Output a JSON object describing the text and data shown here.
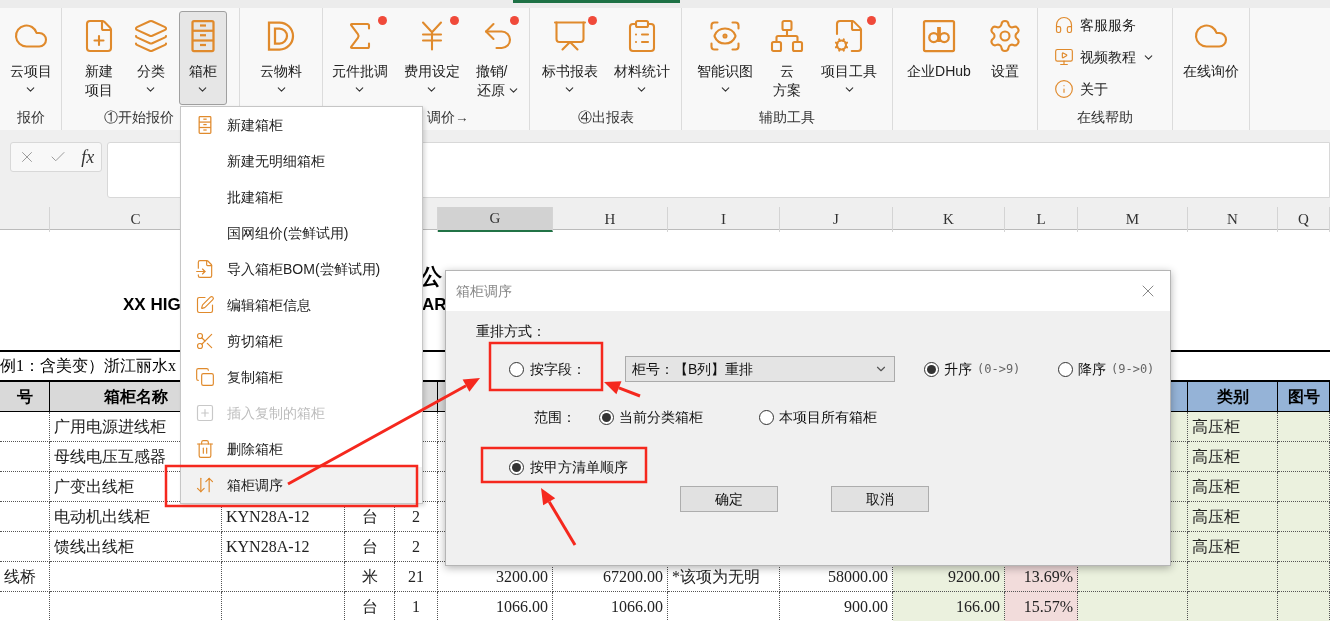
{
  "ribbon": {
    "groups": [
      {
        "label": "报价",
        "kind": "large",
        "buttons": [
          {
            "label": "云项目",
            "dropdown": true,
            "badge": false,
            "pressed": false
          }
        ]
      },
      {
        "label": "①开始报价",
        "kind": "large",
        "buttons": [
          {
            "label_lines": [
              "新建",
              "项目"
            ],
            "dropdown": false,
            "badge": false,
            "pressed": false
          },
          {
            "label": "分类",
            "dropdown": true,
            "badge": false,
            "pressed": false
          },
          {
            "label": "箱柜",
            "dropdown": true,
            "badge": false,
            "pressed": true
          }
        ]
      },
      {
        "kind": "large",
        "buttons": [
          {
            "label": "云物料",
            "dropdown": true,
            "badge": false,
            "pressed": false
          }
        ]
      },
      {
        "label": "调价→",
        "kind": "large",
        "buttons": [
          {
            "label": "元件批调",
            "dropdown": true,
            "badge": true,
            "pressed": false
          },
          {
            "label": "费用设定",
            "dropdown": true,
            "badge": true,
            "pressed": false
          },
          {
            "label_lines": [
              "撤销/",
              "还原"
            ],
            "dropdown": true,
            "badge": true,
            "pressed": false
          }
        ]
      },
      {
        "label": "④出报表",
        "kind": "large",
        "buttons": [
          {
            "label": "标书报表",
            "dropdown": true,
            "badge": true,
            "pressed": false
          },
          {
            "label": "材料统计",
            "dropdown": true,
            "badge": false,
            "pressed": false
          }
        ]
      },
      {
        "label": "辅助工具",
        "kind": "large",
        "buttons": [
          {
            "label": "智能识图",
            "dropdown": true,
            "badge": false,
            "pressed": false
          },
          {
            "label_lines": [
              "云",
              "方案"
            ],
            "dropdown": false,
            "badge": false,
            "pressed": false
          },
          {
            "label": "项目工具",
            "dropdown": true,
            "badge": true,
            "pressed": false
          }
        ]
      },
      {
        "kind": "large",
        "buttons": [
          {
            "label": "企业DHub",
            "dropdown": false,
            "badge": false,
            "pressed": false
          },
          {
            "label": "设置",
            "dropdown": false,
            "badge": false,
            "pressed": false
          }
        ]
      },
      {
        "label": "在线帮助",
        "kind": "list",
        "buttons": [
          {
            "label": "客服服务",
            "dropdown": false
          },
          {
            "label": "视频教程",
            "dropdown": true
          },
          {
            "label": "关于",
            "dropdown": false
          }
        ]
      },
      {
        "kind": "large",
        "buttons": [
          {
            "label": "在线询价",
            "dropdown": false,
            "badge": false,
            "pressed": false
          }
        ]
      }
    ]
  },
  "formula_bar": {
    "function_label": "fx"
  },
  "sheet": {
    "column_headers": [
      {
        "label": "C",
        "selected": false
      },
      {
        "label": "G",
        "selected": true
      },
      {
        "label": "H",
        "selected": false
      },
      {
        "label": "I",
        "selected": false
      },
      {
        "label": "J",
        "selected": false
      },
      {
        "label": "K",
        "selected": false
      },
      {
        "label": "L",
        "selected": false
      },
      {
        "label": "M",
        "selected": false
      },
      {
        "label": "N",
        "selected": false
      },
      {
        "label": "Q",
        "selected": false
      }
    ],
    "title_cn": "公",
    "title_en": [
      "XX HIG",
      "AR"
    ],
    "project_line": "例1：含美变）浙江丽水x",
    "table_header": {
      "item": "号",
      "name": "箱柜名称",
      "category": "类别",
      "drawing_no": "图号"
    },
    "rows": [
      {
        "name": "广用电源进线柜",
        "category": "高压柜"
      },
      {
        "name": "母线电压互感器",
        "category": "高压柜"
      },
      {
        "name": "广变出线柜",
        "category": "高压柜"
      },
      {
        "name": "电动机出线柜",
        "model": "KYN28A-12",
        "unit": "台",
        "qty": "2",
        "category": "高压柜"
      },
      {
        "name": "馈线出线柜",
        "model": "KYN28A-12",
        "unit": "台",
        "qty": "2",
        "category": "高压柜"
      },
      {
        "item": "线桥",
        "unit": "米",
        "qty": "21",
        "price": "3200.00",
        "amount": "67200.00",
        "note": "*该项为无明",
        "cost": "58000.00",
        "profit": "9200.00",
        "rate": "13.69%"
      },
      {
        "unit": "台",
        "qty": "1",
        "price": "1066.00",
        "amount": "1066.00",
        "cost": "900.00",
        "profit": "166.00",
        "rate": "15.57%"
      }
    ]
  },
  "menu": {
    "items": [
      {
        "label": "新建箱柜",
        "disabled": false,
        "selected": false
      },
      {
        "label": "新建无明细箱柜",
        "disabled": false,
        "selected": false
      },
      {
        "label": "批建箱柜",
        "disabled": false,
        "selected": false
      },
      {
        "label": "国网组价(尝鲜试用)",
        "disabled": false,
        "selected": false
      },
      {
        "label": "导入箱柜BOM(尝鲜试用)",
        "disabled": false,
        "selected": false
      },
      {
        "label": "编辑箱柜信息",
        "disabled": false,
        "selected": false
      },
      {
        "label": "剪切箱柜",
        "disabled": false,
        "selected": false
      },
      {
        "label": "复制箱柜",
        "disabled": false,
        "selected": false
      },
      {
        "label": "插入复制的箱柜",
        "disabled": true,
        "selected": false
      },
      {
        "label": "删除箱柜",
        "disabled": false,
        "selected": false
      },
      {
        "label": "箱柜调序",
        "disabled": false,
        "selected": true
      }
    ]
  },
  "dialog": {
    "title": "箱柜调序",
    "section_label": "重排方式：",
    "by_field": {
      "label": "按字段：",
      "selected": false
    },
    "field_select": {
      "value": "柜号：【B列】重排"
    },
    "order_options": [
      {
        "label": "升序",
        "hint": "(0->9)",
        "selected": true
      },
      {
        "label": "降序",
        "hint": "(9->0)",
        "selected": false
      }
    ],
    "scope_label": "范围：",
    "scope_options": [
      {
        "label": "当前分类箱柜",
        "selected": true
      },
      {
        "label": "本项目所有箱柜",
        "selected": false
      }
    ],
    "by_client_list": {
      "label": "按甲方清单顺序",
      "selected": true
    },
    "buttons": [
      {
        "label": "确定"
      },
      {
        "label": "取消"
      }
    ]
  }
}
